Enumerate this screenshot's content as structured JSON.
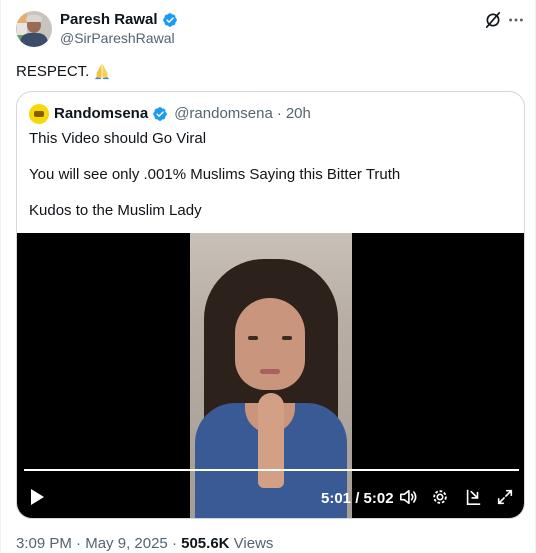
{
  "author": {
    "display_name": "Paresh Rawal",
    "handle": "@SirPareshRawal",
    "verified": true
  },
  "tweet": {
    "text": "RESPECT.",
    "emoji": "folded-hands"
  },
  "quoted": {
    "display_name": "Randomsena",
    "handle": "@randomsena",
    "separator": "·",
    "time": "20h",
    "lines": [
      "This Video should Go Viral",
      "You will see only .001% Muslims Saying this Bitter Truth",
      "Kudos to the Muslim Lady"
    ]
  },
  "video": {
    "time_display": "5:01 / 5:02",
    "progress": 0.997
  },
  "meta": {
    "time": "3:09 PM",
    "dot1": "·",
    "date": "May 9, 2025",
    "dot2": "·",
    "views_count": "505.6K",
    "views_label": "Views"
  },
  "colors": {
    "verified": "#1d9bf0",
    "secondary_text": "#536471",
    "border": "#cfd9de"
  },
  "icons": [
    "verified-badge-icon",
    "grok-icon",
    "more-icon",
    "play-icon",
    "volume-icon",
    "settings-icon",
    "dock-icon",
    "fullscreen-icon"
  ]
}
